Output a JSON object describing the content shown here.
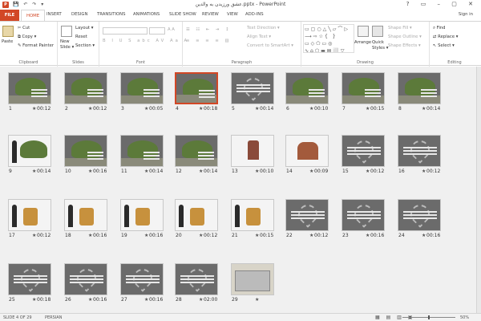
{
  "titlebar": {
    "app_icon": "P",
    "qat": "💾 ↶ ↷ ▾",
    "title": "عشق ورزيدن به والدين.pptx - PowerPoint",
    "win_controls": "? ▭ – ▢ ✕"
  },
  "tabs": [
    "FILE",
    "HOME",
    "INSERT",
    "DESIGN",
    "TRANSITIONS",
    "ANIMATIONS",
    "SLIDE SHOW",
    "REVIEW",
    "VIEW",
    "ADD-INS"
  ],
  "signin": "Sign in",
  "ribbon": {
    "clipboard": {
      "label": "Clipboard",
      "paste": "Paste",
      "cut": "Cut",
      "copy": "Copy ▾",
      "format_painter": "Format Painter"
    },
    "slides": {
      "label": "Slides",
      "new_slide": "New",
      "new_slide2": "Slide ▾",
      "layout": "Layout ▾",
      "reset": "Reset",
      "section": "Section ▾"
    },
    "font": {
      "label": "Font"
    },
    "paragraph": {
      "label": "Paragraph",
      "text_direction": "Text Direction ▾",
      "align_text": "Align Text ▾",
      "convert": "Convert to SmartArt ▾"
    },
    "drawing": {
      "label": "Drawing",
      "arrange": "Arrange",
      "quick_styles": "Quick",
      "quick_styles2": "Styles ▾",
      "shape_fill": "Shape Fill ▾",
      "shape_outline": "Shape Outline ▾",
      "shape_effects": "Shape Effects ▾",
      "shapes_gallery": "▭▢○△╲▱⌒▷ ⟶⇨☆{ }▭◇⬠▭◎ ∿⌂⬡▬▤⬜▽"
    },
    "editing": {
      "label": "Editing",
      "find": "Find",
      "replace": "Replace ▾",
      "select": "Select ▾"
    }
  },
  "slides": [
    {
      "num": "1",
      "time": "00:12"
    },
    {
      "num": "2",
      "time": "00:12"
    },
    {
      "num": "3",
      "time": "00:05"
    },
    {
      "num": "4",
      "time": "00:18"
    },
    {
      "num": "5",
      "time": "00:14"
    },
    {
      "num": "6",
      "time": "00:10"
    },
    {
      "num": "7",
      "time": "00:15"
    },
    {
      "num": "8",
      "time": "00:14"
    },
    {
      "num": "9",
      "time": "00:14"
    },
    {
      "num": "10",
      "time": "00:16"
    },
    {
      "num": "11",
      "time": "00:14"
    },
    {
      "num": "12",
      "time": "00:14"
    },
    {
      "num": "13",
      "time": "00:10"
    },
    {
      "num": "14",
      "time": "00:09"
    },
    {
      "num": "15",
      "time": "00:12"
    },
    {
      "num": "16",
      "time": "00:12"
    },
    {
      "num": "17",
      "time": "00:12"
    },
    {
      "num": "18",
      "time": "00:16"
    },
    {
      "num": "19",
      "time": "00:16"
    },
    {
      "num": "20",
      "time": "00:12"
    },
    {
      "num": "21",
      "time": "00:15"
    },
    {
      "num": "22",
      "time": "00:12"
    },
    {
      "num": "23",
      "time": "00:16"
    },
    {
      "num": "24",
      "time": "00:16"
    },
    {
      "num": "25",
      "time": "00:18"
    },
    {
      "num": "26",
      "time": "00:16"
    },
    {
      "num": "27",
      "time": "00:16"
    },
    {
      "num": "28",
      "time": "02:00"
    },
    {
      "num": "29",
      "time": ""
    }
  ],
  "selected_slide": "4",
  "statusbar": {
    "slide_info": "SLIDE 4 OF 29",
    "language": "PERSIAN",
    "views": "▦ ▤ ▥ ▣",
    "zoom": "50%",
    "zoom_level_percent": 50
  },
  "colors": {
    "accent": "#d24726",
    "sorter_bg": "#f0f0f0"
  }
}
